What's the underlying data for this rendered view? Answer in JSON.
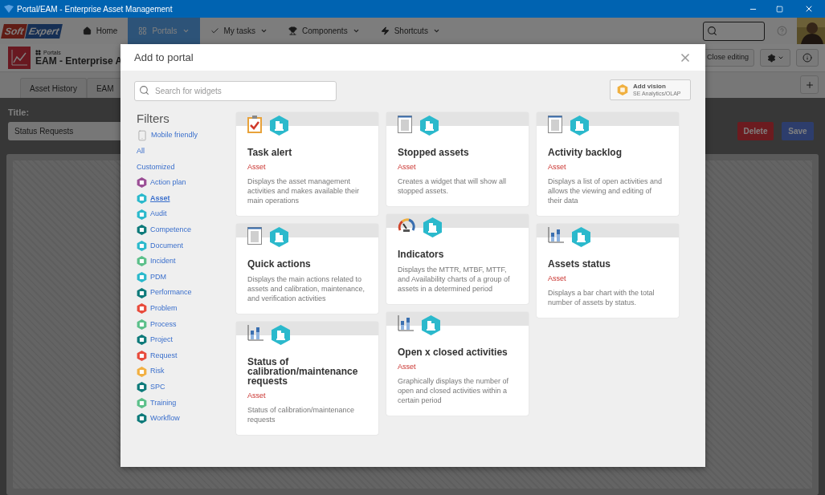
{
  "window": {
    "title": "Portal/EAM - Enterprise Asset Management"
  },
  "nav": {
    "logo": [
      "Soft",
      "Expert"
    ],
    "items": [
      {
        "label": "Home",
        "selected": false,
        "dropdown": false
      },
      {
        "label": "Portals",
        "selected": true,
        "dropdown": true
      },
      {
        "label": "My tasks",
        "selected": false,
        "dropdown": true
      },
      {
        "label": "Components",
        "selected": false,
        "dropdown": true
      },
      {
        "label": "Shortcuts",
        "selected": false,
        "dropdown": true
      }
    ]
  },
  "page_header": {
    "breadcrumb": "Portals",
    "title": "EAM - Enterprise A",
    "close_editing": "Close editing"
  },
  "tabs": [
    {
      "label": "Asset History",
      "selected": false
    },
    {
      "label": "EAM",
      "selected": false
    }
  ],
  "form": {
    "title_label": "Title:",
    "title_value": "Status Requests",
    "delete": "Delete",
    "save": "Save"
  },
  "modal": {
    "title": "Add to portal",
    "search_placeholder": "Search for widgets",
    "add_vision": {
      "label": "Add vision",
      "sublabel": "SE Analytics/OLAP"
    },
    "filters": {
      "title": "Filters",
      "items": [
        {
          "label": "Mobile friendly",
          "kind": "mobile",
          "selected": false
        },
        {
          "label": "All",
          "kind": "link",
          "selected": false
        },
        {
          "label": "Customized",
          "kind": "link",
          "selected": false
        },
        {
          "label": "Action plan",
          "kind": "module",
          "selected": false,
          "color": "#9b4f96"
        },
        {
          "label": "Asset",
          "kind": "module",
          "selected": true,
          "color": "#2bb9cc"
        },
        {
          "label": "Audit",
          "kind": "module",
          "selected": false,
          "color": "#2bb9cc"
        },
        {
          "label": "Competence",
          "kind": "module",
          "selected": false,
          "color": "#0e7a7a"
        },
        {
          "label": "Document",
          "kind": "module",
          "selected": false,
          "color": "#2bb9cc"
        },
        {
          "label": "Incident",
          "kind": "module",
          "selected": false,
          "color": "#5cc08a"
        },
        {
          "label": "PDM",
          "kind": "module",
          "selected": false,
          "color": "#2bb9cc"
        },
        {
          "label": "Performance",
          "kind": "module",
          "selected": false,
          "color": "#0e7a7a"
        },
        {
          "label": "Problem",
          "kind": "module",
          "selected": false,
          "color": "#e84b3c"
        },
        {
          "label": "Process",
          "kind": "module",
          "selected": false,
          "color": "#5cc08a"
        },
        {
          "label": "Project",
          "kind": "module",
          "selected": false,
          "color": "#0e7a7a"
        },
        {
          "label": "Request",
          "kind": "module",
          "selected": false,
          "color": "#e84b3c"
        },
        {
          "label": "Risk",
          "kind": "module",
          "selected": false,
          "color": "#f2b042"
        },
        {
          "label": "SPC",
          "kind": "module",
          "selected": false,
          "color": "#0e7a7a"
        },
        {
          "label": "Training",
          "kind": "module",
          "selected": false,
          "color": "#5cc08a"
        },
        {
          "label": "Workflow",
          "kind": "module",
          "selected": false,
          "color": "#0e7a7a"
        }
      ]
    },
    "columns": [
      [
        {
          "kind": "checklist",
          "title": "Task alert",
          "category": "Asset",
          "description": "Displays the asset management activities and makes available their main operations"
        },
        {
          "kind": "document",
          "title": "Quick actions",
          "description": "Displays the main actions related to assets and calibration, maintenance, and verification activities"
        },
        {
          "kind": "bar-chart",
          "title": "Status of calibration/maintenance requests",
          "category": "Asset",
          "description": "Status of calibration/maintenance requests"
        }
      ],
      [
        {
          "kind": "document",
          "title": "Stopped assets",
          "category": "Asset",
          "description": "Creates a widget that will show all stopped assets."
        },
        {
          "kind": "gauge",
          "title": "Indicators",
          "description": "Displays the MTTR, MTBF, MTTF, and Availability charts of a group of assets in a determined period"
        },
        {
          "kind": "bar-chart",
          "title": "Open x closed activities",
          "category": "Asset",
          "description": "Graphically displays the number of open and closed activities within a certain period"
        }
      ],
      [
        {
          "kind": "document",
          "title": "Activity backlog",
          "category": "Asset",
          "description": "Displays a list of open activities and allows the viewing and editing of their data"
        },
        {
          "kind": "bar-chart",
          "title": "Assets status",
          "category": "Asset",
          "description": "Displays a bar chart with the total number of assets by status."
        }
      ]
    ]
  }
}
